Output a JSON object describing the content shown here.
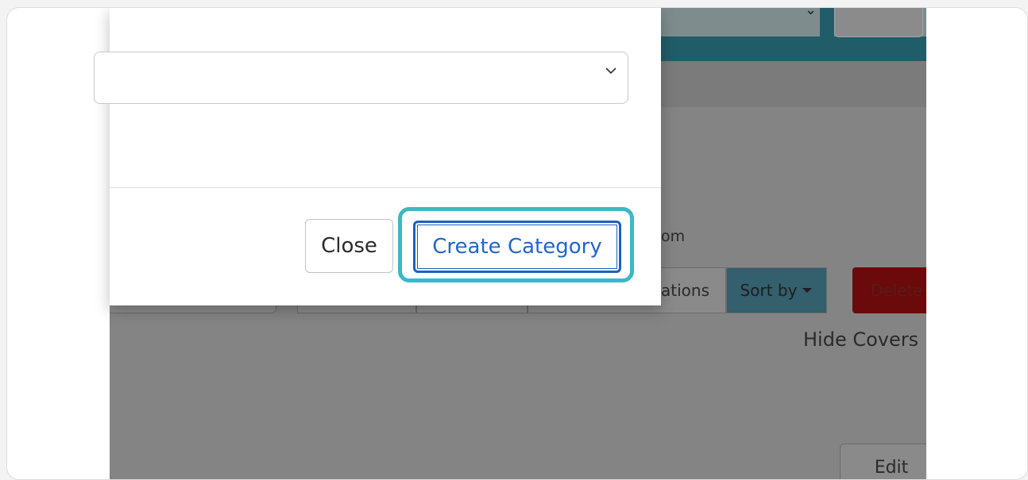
{
  "modal": {
    "select_value": "",
    "select_icon": "chevron-down-icon",
    "close_label": "Close",
    "create_label": "Create Category"
  },
  "background": {
    "partial_text_om": "om",
    "partial_tab_label": "ations",
    "sort_label": "Sort by",
    "sort_icon": "caret-down-icon",
    "delete_label": "Delete",
    "hide_covers_label": "Hide Covers",
    "edit_label": "Edit",
    "header_select_icon": "chevron-down-icon"
  },
  "colors": {
    "highlight": "#3bb8c6",
    "primary": "#1f5fc0",
    "teal_header": "#215c69",
    "delete": "#6b0a0a"
  }
}
